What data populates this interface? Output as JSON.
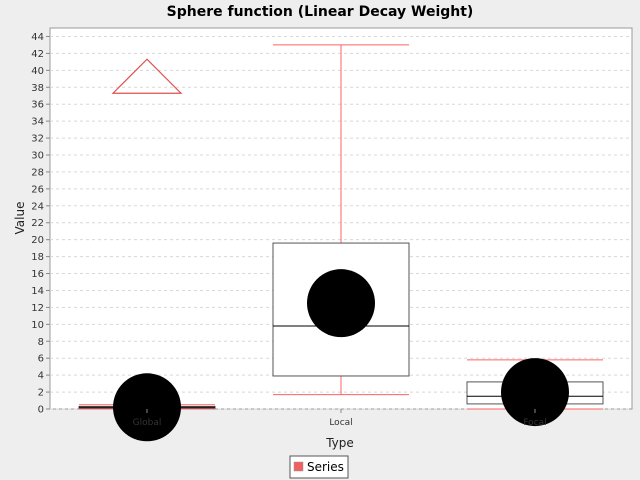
{
  "chart_data": {
    "type": "box",
    "title": "Sphere function (Linear Decay Weight)",
    "xlabel": "Type",
    "ylabel": "Value",
    "ylim": [
      0,
      45
    ],
    "yticks": [
      0,
      2,
      4,
      6,
      8,
      10,
      12,
      14,
      16,
      18,
      20,
      22,
      24,
      26,
      28,
      30,
      32,
      34,
      36,
      38,
      40,
      42,
      44
    ],
    "grid": true,
    "legend": {
      "position": "bottom-center",
      "entries": [
        "Series"
      ]
    },
    "categories": [
      "Global",
      "Local",
      "Focal"
    ],
    "series": [
      {
        "name": "Series",
        "boxes": [
          {
            "category": "Global",
            "min": 0.0,
            "q1": 0.1,
            "median": 0.2,
            "q3": 0.3,
            "max": 0.5,
            "mean": 0.2,
            "outliers": [],
            "far_outliers": [
              38.9
            ]
          },
          {
            "category": "Local",
            "min": 1.7,
            "q1": 3.9,
            "median": 9.8,
            "q3": 19.6,
            "max": 43.0,
            "mean": 12.5,
            "outliers": [],
            "far_outliers": []
          },
          {
            "category": "Focal",
            "min": 0.0,
            "q1": 0.6,
            "median": 1.5,
            "q3": 3.2,
            "max": 5.8,
            "mean": 2.0,
            "outliers": [],
            "far_outliers": []
          }
        ]
      }
    ]
  },
  "colors": {
    "whisker": "#ff6060",
    "box_stroke": "#555555",
    "median": "#000000",
    "mean": "#000000",
    "far_outlier": "#e05050",
    "legend_swatch": "#f06060",
    "plot_bg": "#ffffff",
    "grid": "#d8d8d8"
  }
}
